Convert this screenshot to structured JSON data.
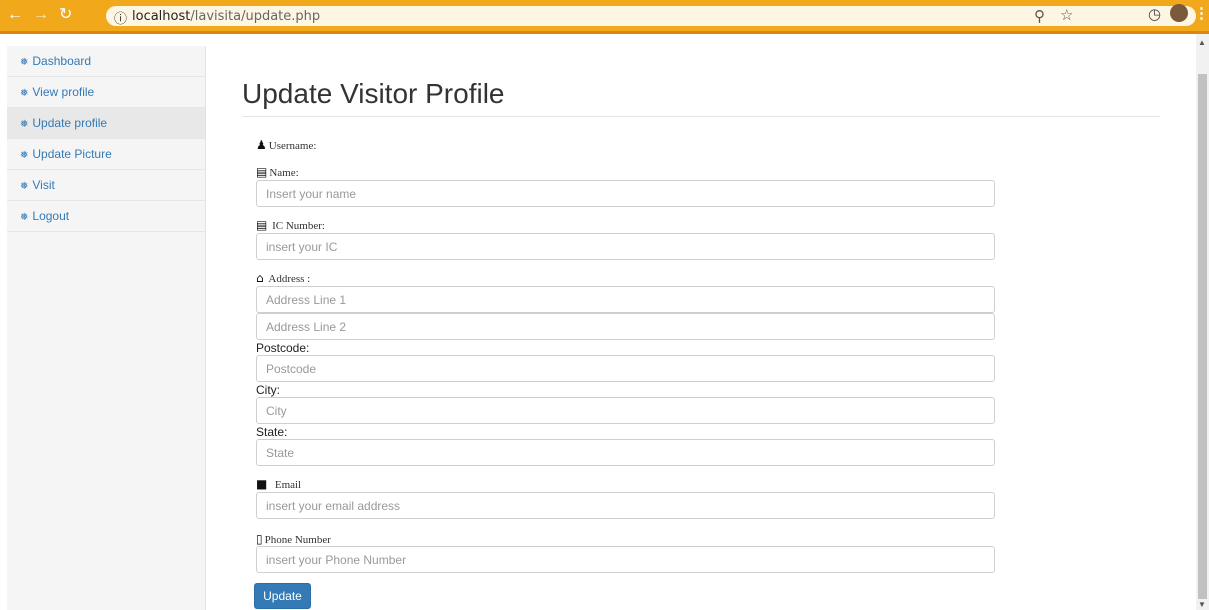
{
  "browser": {
    "url_host": "localhost",
    "url_path": "/lavisita/update.php"
  },
  "sidebar": {
    "items": [
      {
        "label": "Dashboard"
      },
      {
        "label": "View profile"
      },
      {
        "label": "Update profile"
      },
      {
        "label": "Update Picture"
      },
      {
        "label": "Visit"
      },
      {
        "label": "Logout"
      }
    ]
  },
  "main": {
    "title": "Update Visitor Profile",
    "username_label": "Username:",
    "name_label": "Name:",
    "name_placeholder": "Insert your name",
    "ic_label": "IC  Number:",
    "ic_placeholder": "insert your IC",
    "address_label": "Address :",
    "address1_placeholder": "Address Line 1",
    "address2_placeholder": "Address Line 2",
    "postcode_label": "Postcode:",
    "postcode_placeholder": "Postcode",
    "city_label": "City:",
    "city_placeholder": "City",
    "state_label": "State:",
    "state_placeholder": "State",
    "email_label": "Email",
    "email_placeholder": "insert your email address",
    "phone_label": "Phone  Number",
    "phone_placeholder": "insert your Phone Number",
    "update_button": "Update"
  },
  "colors": {
    "chrome": "#f1a81b",
    "link": "#337ab7",
    "button": "#337ab7"
  }
}
